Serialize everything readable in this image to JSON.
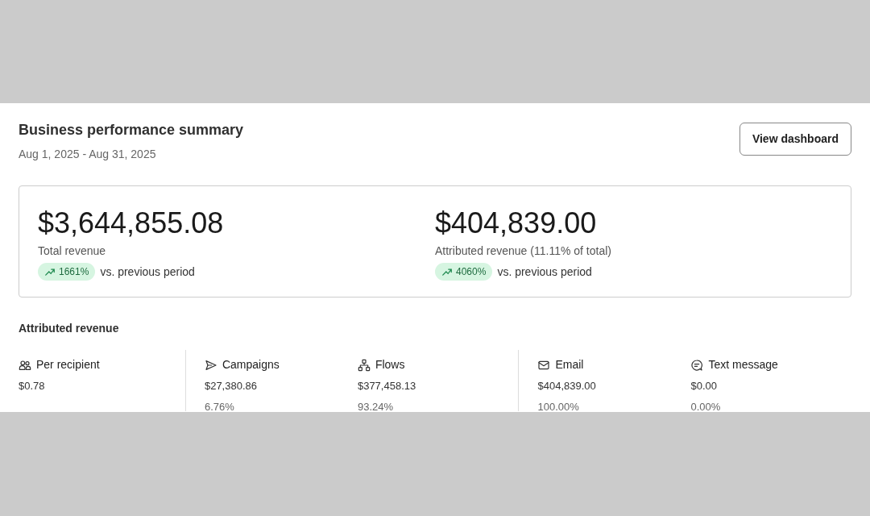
{
  "card": {
    "title": "Business performance summary",
    "date_range": "Aug 1, 2025 - Aug 31, 2025",
    "button": "View dashboard"
  },
  "totals": [
    {
      "amount": "$3,644,855.08",
      "label": "Total revenue",
      "change": "1661%",
      "comparison": "vs. previous period"
    },
    {
      "amount": "$404,839.00",
      "label": "Attributed revenue (11.11% of total)",
      "change": "4060%",
      "comparison": "vs. previous period"
    }
  ],
  "attributed": {
    "heading": "Attributed revenue",
    "groups": [
      {
        "metrics": [
          {
            "kind": "recipients",
            "label": "Per recipient",
            "value": "$0.78"
          }
        ]
      },
      {
        "metrics": [
          {
            "kind": "campaigns",
            "label": "Campaigns",
            "value": "$27,380.86",
            "share": "6.76%"
          },
          {
            "kind": "flows",
            "label": "Flows",
            "value": "$377,458.13",
            "share": "93.24%"
          }
        ]
      },
      {
        "metrics": [
          {
            "kind": "email",
            "label": "Email",
            "value": "$404,839.00",
            "share": "100.00%"
          },
          {
            "kind": "sms",
            "label": "Text message",
            "value": "$0.00",
            "share": "0.00%"
          }
        ]
      }
    ]
  }
}
